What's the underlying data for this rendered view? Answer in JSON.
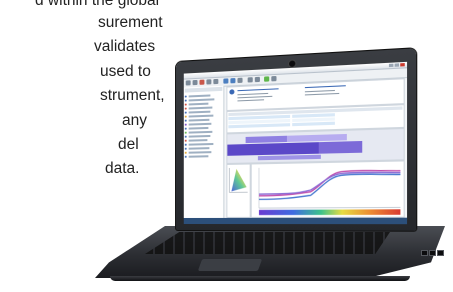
{
  "marketing_copy": {
    "lines": [
      "d within the global",
      "surement",
      "validates",
      "used to",
      "strument,",
      "any",
      "del",
      "data."
    ]
  },
  "colors": {
    "status_bar": "#2c4f7a",
    "heatmap_band": "#5b48c8",
    "heatmap_light": "#b7acf0",
    "accent_green": "#5fb64b"
  },
  "icons": [
    "webcam-icon",
    "window-close-icon",
    "toolbar-icon"
  ]
}
